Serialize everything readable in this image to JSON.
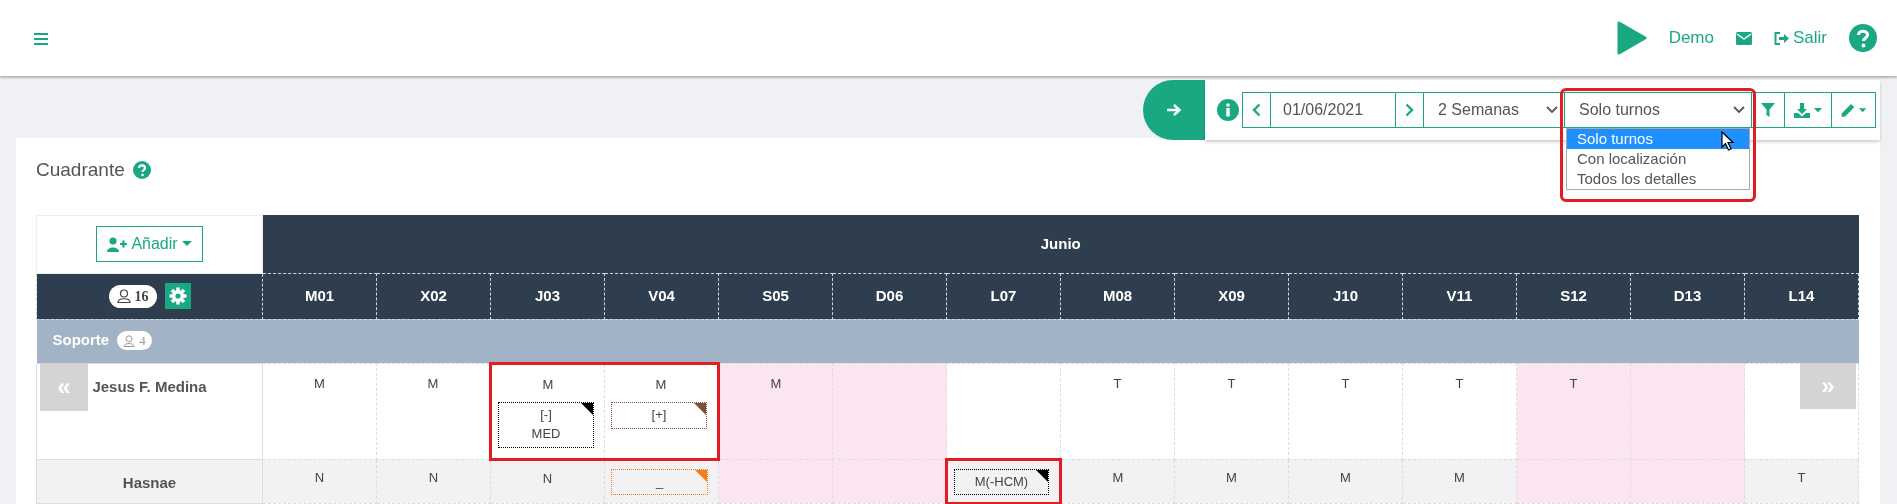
{
  "navbar": {
    "user_label": "Demo",
    "logout_label": "Salir"
  },
  "toolbar": {
    "date": "01/06/2021",
    "period": "2 Semanas",
    "view": {
      "value": "Solo turnos",
      "open": true,
      "highlighted": true,
      "options": [
        {
          "label": "Solo turnos",
          "selected": true
        },
        {
          "label": "Con localización",
          "selected": false
        },
        {
          "label": "Todos los detalles",
          "selected": false
        }
      ]
    }
  },
  "card": {
    "title": "Cuadrante"
  },
  "table": {
    "add_button": "Añadir",
    "staff_count": "16",
    "month": "Junio",
    "scroll_left": "«",
    "scroll_right": "»",
    "days": [
      {
        "label": "M01",
        "weekend": false
      },
      {
        "label": "X02",
        "weekend": false
      },
      {
        "label": "J03",
        "weekend": false
      },
      {
        "label": "V04",
        "weekend": false
      },
      {
        "label": "S05",
        "weekend": true
      },
      {
        "label": "D06",
        "weekend": true
      },
      {
        "label": "L07",
        "weekend": false
      },
      {
        "label": "M08",
        "weekend": false
      },
      {
        "label": "X09",
        "weekend": false
      },
      {
        "label": "J10",
        "weekend": false
      },
      {
        "label": "V11",
        "weekend": false
      },
      {
        "label": "S12",
        "weekend": true
      },
      {
        "label": "D13",
        "weekend": true
      },
      {
        "label": "L14",
        "weekend": false
      }
    ],
    "groups": [
      {
        "name": "Soporte",
        "count": "4",
        "rows": [
          {
            "name": "Jesus F. Medina",
            "shaded": false,
            "cells": [
              {
                "shift": "M",
                "highlighted": false
              },
              {
                "shift": "M",
                "highlighted": false
              },
              {
                "shift": "M",
                "highlighted": true,
                "note": {
                  "text": "[-]\nMED",
                  "color": "#000000"
                }
              },
              {
                "shift": "M",
                "highlighted": true,
                "note": {
                  "text": "[+]",
                  "color": "#7b4f3a"
                }
              },
              {
                "shift": "M",
                "highlighted": false
              },
              {
                "highlighted": false
              },
              {
                "highlighted": false
              },
              {
                "shift": "T",
                "highlighted": false
              },
              {
                "shift": "T",
                "highlighted": false
              },
              {
                "shift": "T",
                "highlighted": false
              },
              {
                "shift": "T",
                "highlighted": false
              },
              {
                "shift": "T",
                "highlighted": false
              },
              {
                "highlighted": false
              },
              {
                "highlighted": false
              }
            ]
          },
          {
            "name": "Hasnae",
            "shaded": true,
            "cells": [
              {
                "shift": "N",
                "highlighted": false
              },
              {
                "shift": "N",
                "highlighted": false
              },
              {
                "shift": "N",
                "highlighted": false
              },
              {
                "highlighted": false,
                "note": {
                  "text": "_",
                  "color": "#f57c1f"
                }
              },
              {
                "highlighted": false
              },
              {
                "highlighted": false
              },
              {
                "highlighted": true,
                "note": {
                  "text": "M(-HCM)",
                  "color": "#000000"
                }
              },
              {
                "shift": "M",
                "highlighted": false
              },
              {
                "shift": "M",
                "highlighted": false
              },
              {
                "shift": "M",
                "highlighted": false
              },
              {
                "shift": "M",
                "highlighted": false
              },
              {
                "highlighted": false
              },
              {
                "highlighted": false
              },
              {
                "shift": "T",
                "highlighted": false
              }
            ]
          }
        ]
      }
    ]
  }
}
